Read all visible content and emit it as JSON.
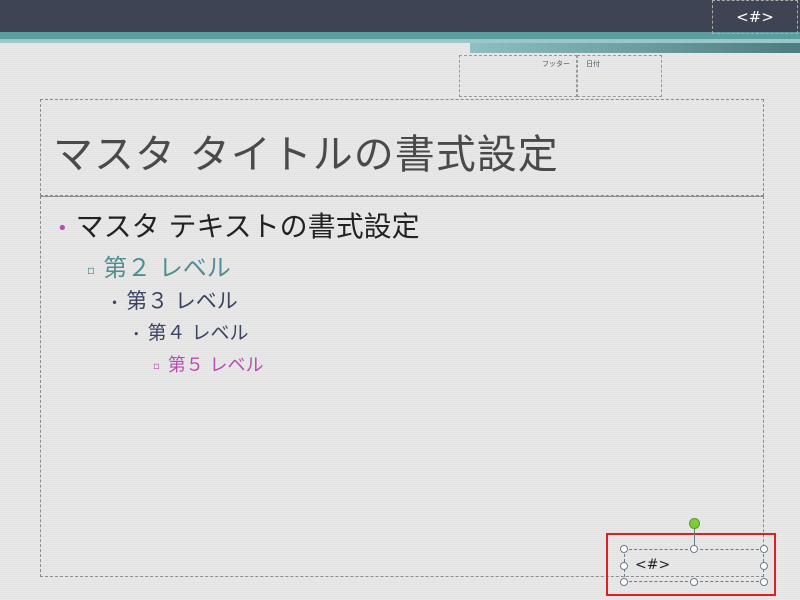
{
  "slide_master": {
    "top_slide_number": "<#>",
    "footer_label": "フッター",
    "date_label": "日付",
    "title": "マスタ タイトルの書式設定",
    "body_levels": [
      {
        "text": "マスタ テキストの書式設定",
        "bullet": "•"
      },
      {
        "text": "第２ レベル",
        "bullet": "▫"
      },
      {
        "text": "第３ レベル",
        "bullet": "•"
      },
      {
        "text": "第４ レベル",
        "bullet": "•"
      },
      {
        "text": "第５ レベル",
        "bullet": "▫"
      }
    ],
    "selected_slide_number": "<#>"
  },
  "colors": {
    "banner": "#3f4455",
    "teal": "#5a9ea0",
    "accent_purple": "#b54eb0",
    "selection_highlight": "#e02020",
    "rotation_handle": "#7ccc3c"
  }
}
